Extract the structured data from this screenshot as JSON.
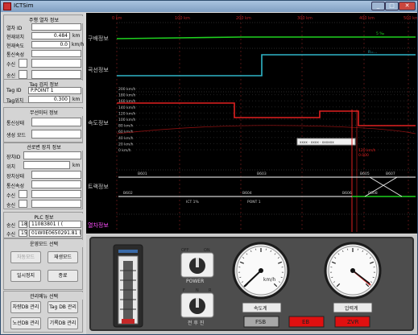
{
  "window": {
    "title": "ICTSim",
    "min": "_",
    "max": "□",
    "close": "✕"
  },
  "train": {
    "title": "주행 열차 정보",
    "id_label": "열차 ID",
    "id_value": "",
    "pos_label": "현재위치",
    "pos_value": "0.484",
    "pos_unit": "km",
    "speed_label": "현재속도",
    "speed_value": "0.0",
    "speed_unit": "km/h",
    "comm_label": "통신속성",
    "rx_label": "수신",
    "tx_label": "송신"
  },
  "tag": {
    "title": "Tag 검지 정보",
    "id_label": "Tag ID",
    "id_value": "P.POINT 1",
    "pos_label": "Tag위치",
    "pos_value": "0.300",
    "pos_unit": "km"
  },
  "radio": {
    "title": "무선미터 정보",
    "comm_label": "통신상태",
    "mode_label": "생성 모드"
  },
  "wayside": {
    "title": "선로변 장치 정보",
    "id_label": "장치ID",
    "pos_label": "위치",
    "pos_unit": "km",
    "status_label": "장치상태",
    "comm_label": "통신속성",
    "rx_label": "수신",
    "tx_label": "송신"
  },
  "plc": {
    "title": "PLC 정보",
    "tx_label": "송신",
    "tx_num": "18",
    "tx_value": "11083801 ( (",
    "rx_label": "수신",
    "rx_num": "15",
    "rx_value": "01W0E0650291.81 ( ("
  },
  "mode": {
    "title": "운영모드 선택",
    "auto": "자동모드",
    "manual": "재생모드",
    "pause": "일시정지",
    "end": "종료"
  },
  "manage": {
    "title": "관리메뉴 선택",
    "track_db": "차량DB 관리",
    "tag_db": "Tag DB 관리",
    "route_db": "노선DB 관리",
    "record_db": "기록DB 관리"
  },
  "chart_data": {
    "type": "line",
    "row_labels": [
      "구배정보",
      "곡선정보",
      "속도정보",
      "트랙정보",
      "열차정보"
    ],
    "top_ticks": [
      "0 km",
      "100 km",
      "200 km",
      "300 km",
      "400 km",
      "500 km"
    ],
    "speed_ticks": [
      "200 km/h",
      "180 km/h",
      "160 km/h",
      "140 km/h",
      "120 km/h",
      "100 km/h",
      "80 km/h",
      "60 km/h",
      "40 km/h",
      "20 km/h",
      "0 km/h"
    ],
    "curve_label": "R=...",
    "grade_label": "5 ‰",
    "series": [
      {
        "name": "",
        "color": "#1fd11f"
      },
      {
        "name": "",
        "color": "#2fb6c8"
      },
      {
        "name": "",
        "color": "#e02020"
      }
    ],
    "track_labels": [
      "B601",
      "B603",
      "B605",
      "B607",
      "B602",
      "B604",
      "B606",
      "B608"
    ],
    "track_sub": [
      "ICT 1%",
      "PONT 1"
    ],
    "info_box": "xxxx · xxxx · xxxxxx",
    "limit_label": "120 km/h",
    "limit_sub": "0.000"
  },
  "console": {
    "power_label": "POWER",
    "off": "OFF",
    "on": "ON",
    "direction_label": "전 후 진",
    "fwd": "F",
    "n": "N",
    "rev": "R",
    "gauge1_label": "속도계",
    "gauge1_unit": "km/h",
    "gauge2_label": "압력계",
    "fsb": "FSB",
    "eb": "EB",
    "zvr": "ZVR"
  },
  "colors": {
    "green": "#1fd11f",
    "cyan": "#2fb6c8",
    "red": "#e02020",
    "magenta": "#ff4fff",
    "eb_red": "#e01010",
    "fsb_gray": "#a8a8a8"
  }
}
